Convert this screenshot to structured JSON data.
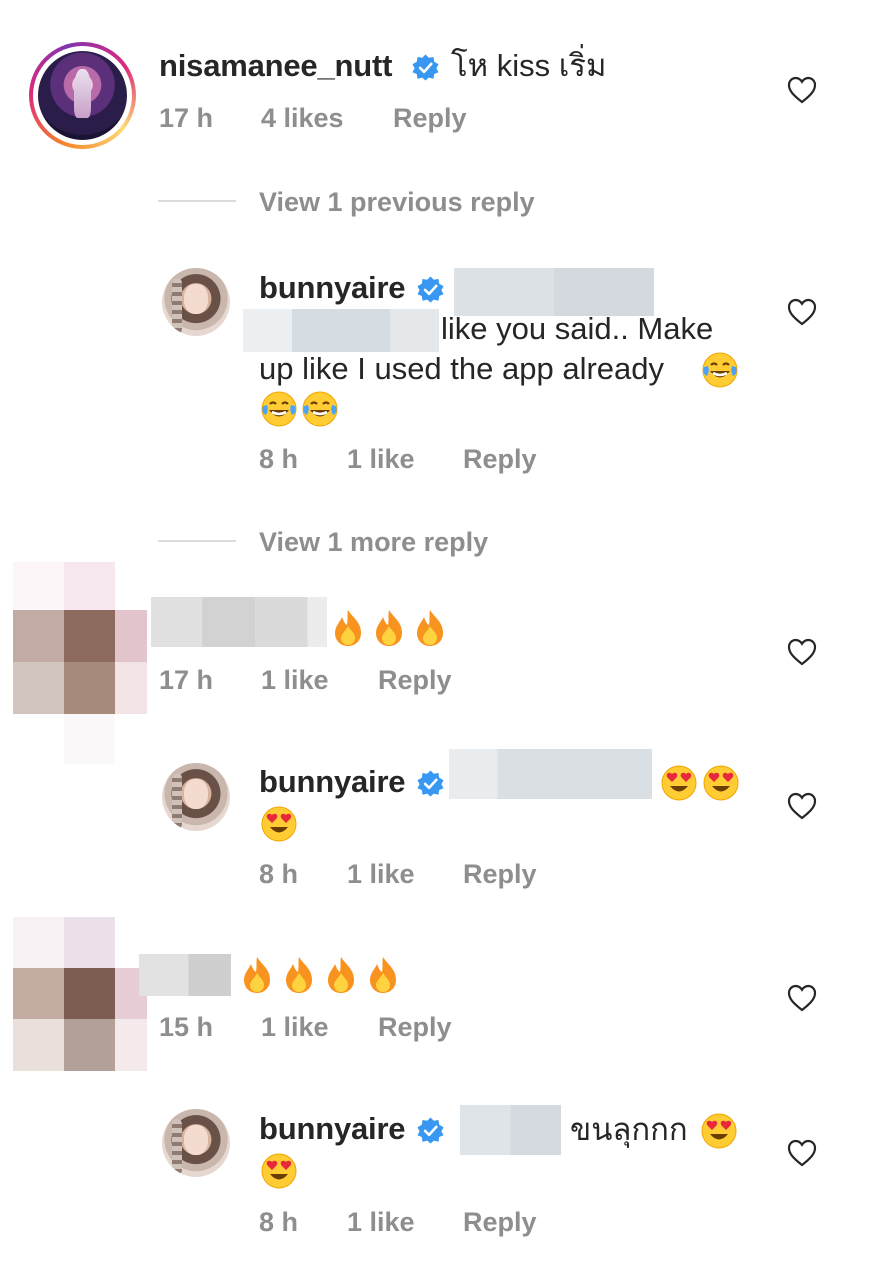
{
  "comments": [
    {
      "username": "nisamanee_nutt",
      "text": "โห kiss เริ่ม",
      "time": "17 h",
      "likes": "4 likes",
      "reply": "Reply",
      "view_replies": "View 1 previous reply"
    },
    {
      "username": "bunnyaire",
      "text_line1": "like you said.. Make",
      "text_line2": "up like I used the app already",
      "time": "8 h",
      "likes": "1 like",
      "reply": "Reply",
      "view_replies": "View 1 more reply"
    },
    {
      "time": "17 h",
      "likes": "1 like",
      "reply": "Reply"
    },
    {
      "username": "bunnyaire",
      "time": "8 h",
      "likes": "1 like",
      "reply": "Reply"
    },
    {
      "time": "15 h",
      "likes": "1 like",
      "reply": "Reply"
    },
    {
      "username": "bunnyaire",
      "text": "ขนลุกกก",
      "time": "8 h",
      "likes": "1 like",
      "reply": "Reply"
    }
  ],
  "icons": {
    "verified": "verified-badge-icon",
    "like": "heart-outline-icon",
    "emoji_laugh": "face-with-tears-of-joy",
    "emoji_fire": "fire",
    "emoji_heart_eyes": "smiling-face-with-heart-eyes"
  },
  "colors": {
    "verified": "#3897f0",
    "meta": "#8e8e8e",
    "text": "#262626",
    "divider": "#dbdbdb"
  }
}
